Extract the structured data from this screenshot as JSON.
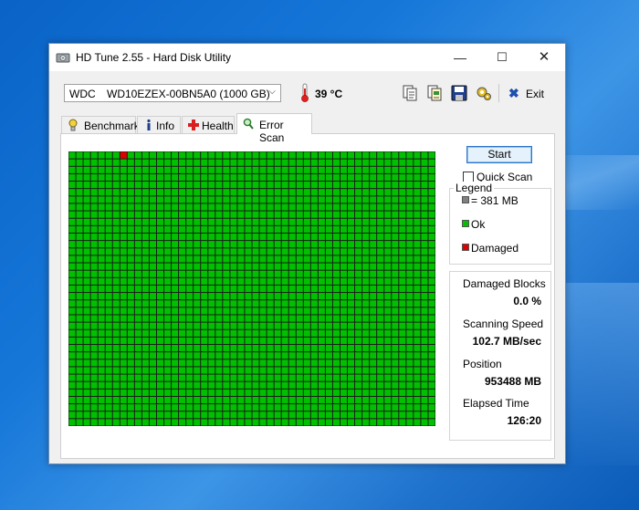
{
  "window": {
    "title": "HD Tune 2.55 - Hard Disk Utility",
    "controls": {
      "minimize": "—",
      "maximize": "☐",
      "close": "✕"
    }
  },
  "toolbar": {
    "drive_vendor": "WDC",
    "drive_model": "WD10EZEX-00BN5A0 (1000 GB)",
    "temperature": "39 °C",
    "exit_label": "Exit",
    "icons": [
      "copy-text-icon",
      "copy-info-icon",
      "save-icon",
      "options-icon"
    ]
  },
  "tabs": [
    {
      "label": "Benchmark",
      "icon": "benchmark-icon"
    },
    {
      "label": "Info",
      "icon": "info-icon"
    },
    {
      "label": "Health",
      "icon": "health-icon"
    },
    {
      "label": "Error Scan",
      "icon": "magnifier-icon",
      "active": true
    }
  ],
  "scan": {
    "start_label": "Start",
    "quick_scan_label": "Quick Scan",
    "quick_scan_checked": false,
    "legend": {
      "title": "Legend",
      "items": [
        {
          "label": "= 381 MB",
          "color": "#808080"
        },
        {
          "label": "Ok",
          "color": "#00c000"
        },
        {
          "label": "Damaged",
          "color": "#e00000"
        }
      ]
    },
    "stats": {
      "damaged_blocks": {
        "label": "Damaged Blocks",
        "value": "0.0 %"
      },
      "scanning_speed": {
        "label": "Scanning Speed",
        "value": "102.7 MB/sec"
      },
      "position": {
        "label": "Position",
        "value": "953488 MB"
      },
      "elapsed_time": {
        "label": "Elapsed Time",
        "value": "126:20"
      }
    },
    "block_grid": {
      "columns": 50,
      "rows": 37,
      "ok_color": "#00c000",
      "damaged_color": "#e00000",
      "damaged_blocks": [
        [
          0,
          7
        ]
      ]
    }
  }
}
